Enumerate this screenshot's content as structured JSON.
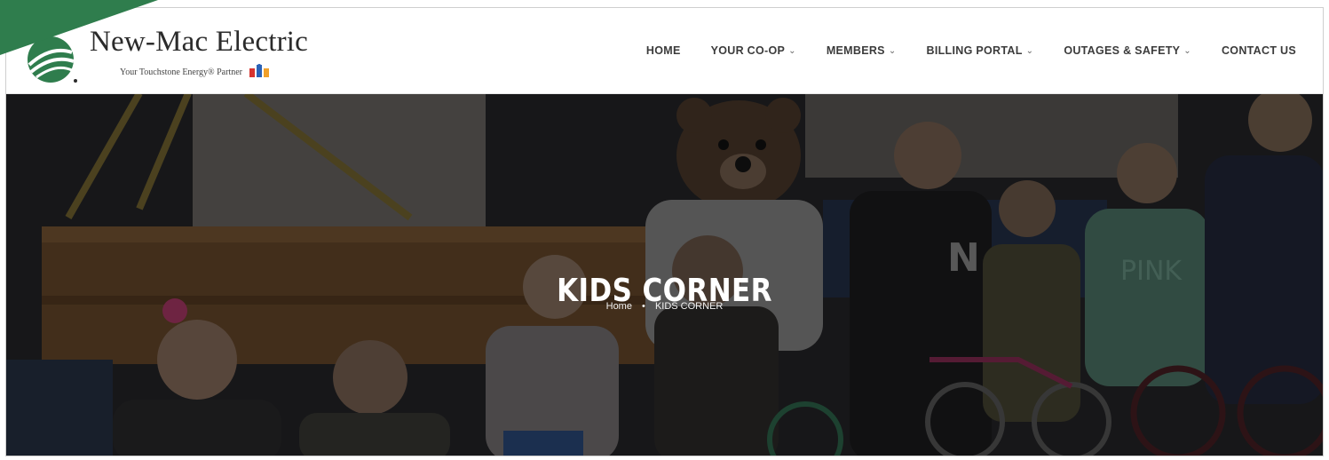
{
  "brand": {
    "name": "New-Mac Electric",
    "tagline": "Your Touchstone Energy® Partner",
    "colors": {
      "green": "#2f7d4d",
      "dark": "#2b2b2b"
    }
  },
  "nav": {
    "items": [
      {
        "label": "HOME",
        "has_dropdown": false
      },
      {
        "label": "YOUR CO-OP",
        "has_dropdown": true
      },
      {
        "label": "MEMBERS",
        "has_dropdown": true
      },
      {
        "label": "BILLING PORTAL",
        "has_dropdown": true
      },
      {
        "label": "OUTAGES & SAFETY",
        "has_dropdown": true
      },
      {
        "label": "CONTACT US",
        "has_dropdown": false
      }
    ],
    "dropdown_icon": "chevron-down-icon"
  },
  "hero": {
    "title": "KIDS CORNER",
    "breadcrumb": {
      "home": "Home",
      "separator": "•",
      "current": "KIDS CORNER"
    }
  }
}
